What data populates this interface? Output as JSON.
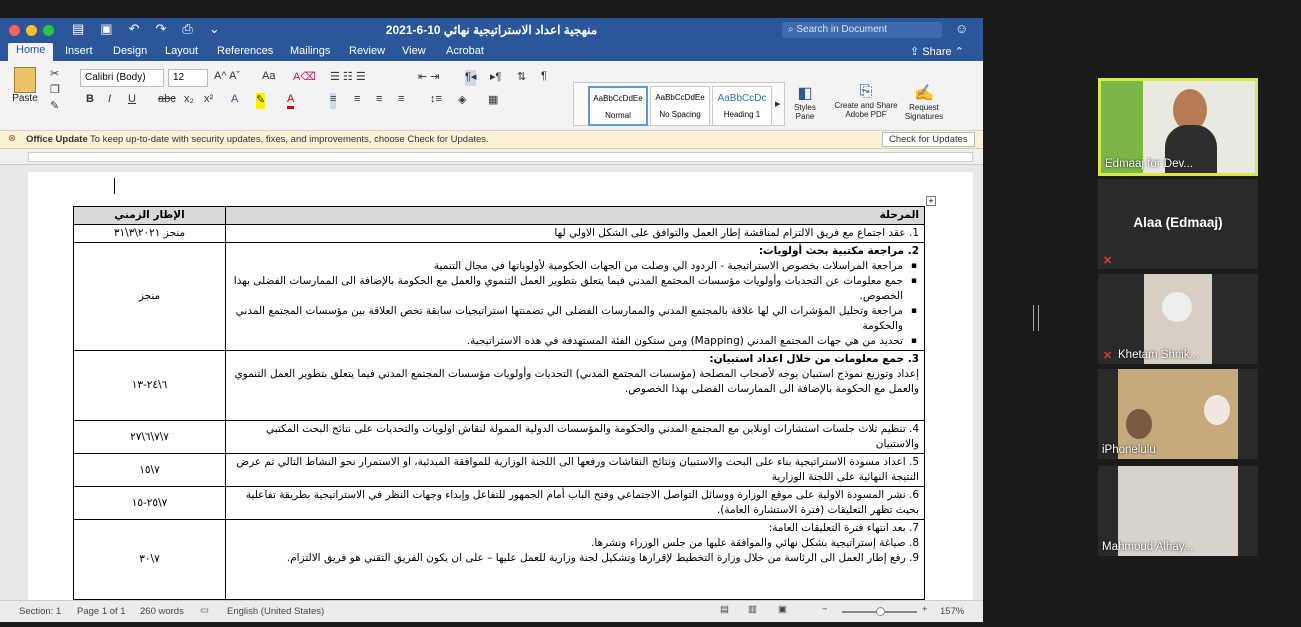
{
  "window": {
    "title": "منهجية اعداد الاستراتيجية نهائي 10-6-2021",
    "search_placeholder": "Search in Document"
  },
  "tabs": [
    "Home",
    "Insert",
    "Design",
    "Layout",
    "References",
    "Mailings",
    "Review",
    "View",
    "Acrobat"
  ],
  "share_label": "Share",
  "ribbon": {
    "paste": "Paste",
    "font": "Calibri (Body)",
    "size": "12",
    "styles": [
      {
        "preview": "AaBbCcDdEe",
        "name": "Normal"
      },
      {
        "preview": "AaBbCcDdEe",
        "name": "No Spacing"
      },
      {
        "preview": "AaBbCcDc",
        "name": "Heading 1"
      }
    ],
    "styles_pane": "Styles Pane",
    "create_pdf": "Create and Share Adobe PDF",
    "request_sig": "Request Signatures"
  },
  "update": {
    "title": "Office Update",
    "message": "To keep up-to-date with security updates, fixes, and improvements, choose Check for Updates.",
    "button": "Check for Updates"
  },
  "table": {
    "head": {
      "stage": "المرحلة",
      "time": "الإطار الزمني"
    },
    "rows": [
      {
        "time": "منجز ٢٠٢١\\٣\\٣١",
        "lines": [
          "1.  عقد اجتماع مع فريق الالتزام لمناقشة إطار العمل والتوافق على الشكل الاولي لها"
        ]
      },
      {
        "time": "منجز",
        "title": "2.  مراجعة مكتبية بحث أولويات:",
        "bullets": [
          "مراجعة المراسلات بخصوص الاستراتيجية - الردود الي وصلت من الجهات الحكومية لأولوياتها في مجال التنمية",
          "جمع معلومات عن التحديات وأولويات مؤسسات المجتمع المدني فيما يتعلق بتطوير العمل التنموي والعمل مع الحكومة بالإضافة الى الممارسات الفضلى بهذا الخصوص.",
          "مراجعة وتحليل المؤشرات الي لها علاقة بالمجتمع المدني والممارسات الفضلى الي تضمنتها استراتيجيات سابقة تخص العلاقة بين مؤسسات المجتمع المدني والحكومة",
          "تحديد من هي جهات المجتمع المدني (Mapping) ومن ستكون الفئة المستهدفة في هذه الاستراتيجية."
        ]
      },
      {
        "time": "٦\\٢٤-١٣",
        "title": "3.  جمع معلومات من خلال اعداد استبيان:",
        "lines": [
          "إعداد وتوزيع نموذج استبيان يوجه لأصحاب المصلحة (مؤسسات المجتمع المدني) التحديات وأولويات مؤسسات المجتمع المدني فيما يتعلق بتطوير العمل التنموي والعمل مع الحكومة بالإضافة الى الممارسات الفضلى بهذا الخصوص."
        ]
      },
      {
        "time": "٧\\٧\\٦\\٢٧",
        "lines": [
          "4.  تنظيم ثلاث جلسات استشارات اونلاين مع المجتمع المدني والحكومة والمؤسسات الدولية الممولة لنقاش اولويات والتحديات على نتائج البحث المكتبي والاستبيان"
        ]
      },
      {
        "time": "٧\\١٥",
        "lines": [
          "5.  اعداد مسودة الاستراتيجية بناء على البحث والاستبيان ونتائج النقاشات ورفعها الى اللجنة الوزارية للموافقة المبدئية، او الاستمرار نحو النشاط التالي ثم عرض النتيجة النهائية على اللجنة الوزارية"
        ]
      },
      {
        "time": "٧\\٢٥-١٥",
        "lines": [
          "6.  نشر المسودة الاولية على موقع الوزارة ووسائل التواصل الاجتماعي وفتح الباب أمام الجمهور للتفاعل وإبداء وجهات النظر في الاستراتيجية بطريقة تفاعلية بحيث تظهر التعليقات (فترة الاستشارة العامة)."
        ]
      },
      {
        "time": "٧\\٣٠",
        "lines": [
          "7.  بعد انتهاء فترة التعليقات العامة:",
          "8.  صياغة إستراتيجية بشكل نهائي والموافقة عليها من جلس الوزراء ونشرها.",
          "9.  رفع إطار العمل الى الرئاسة من خلال وزارة التخطيط لإقرارها وتشكيل لجنة وزارية للعمل عليها – على ان يكون الفريق التقني هو فريق الالتزام."
        ]
      }
    ]
  },
  "status": {
    "section": "Section: 1",
    "page": "Page 1 of 1",
    "words": "260 words",
    "language": "English (United States)",
    "zoom": "157%"
  },
  "participants": [
    {
      "name": "Edmaaj for Dev..."
    },
    {
      "name": "Alaa (Edmaaj)"
    },
    {
      "name": "Khetam Shnik..."
    },
    {
      "name": "iPhonelulu"
    },
    {
      "name": "Mahmoud Alhay..."
    }
  ],
  "colors": {
    "word_blue": "#2b579a",
    "active_speaker": "#d7e84a",
    "mute": "#e53935"
  }
}
